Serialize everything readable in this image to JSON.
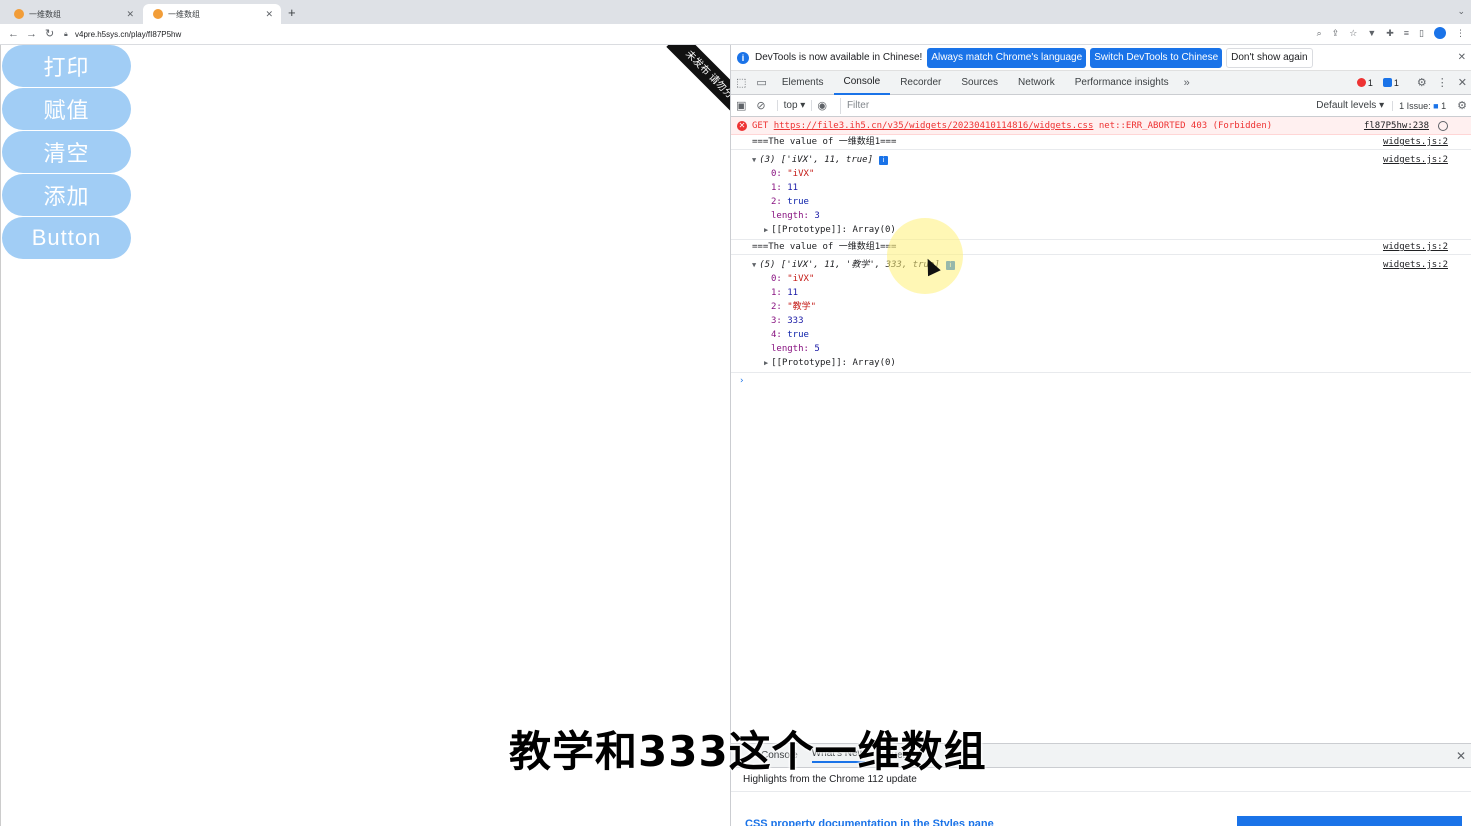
{
  "browser": {
    "tabs": [
      {
        "title": "一维数组",
        "active": false
      },
      {
        "title": "一维数组",
        "active": true
      }
    ],
    "address": "v4pre.h5sys.cn/play/fI87P5hw"
  },
  "page": {
    "buttons": [
      "打印",
      "赋值",
      "清空",
      "添加",
      "Button"
    ],
    "ribbon_text": "未发布 请勿分享",
    "button_color": "#a1cdf5"
  },
  "devtools": {
    "infobar": {
      "message": "DevTools is now available in Chinese!",
      "btn_match": "Always match Chrome's language",
      "btn_switch": "Switch DevTools to Chinese",
      "btn_dismiss": "Don't show again"
    },
    "tabs": [
      "Elements",
      "Console",
      "Recorder",
      "Sources",
      "Network",
      "Performance insights"
    ],
    "error_count": "1",
    "message_count": "1",
    "context": "top",
    "filter_placeholder": "Filter",
    "levels": "Default levels",
    "issues": "1 Issue:",
    "issues_count": "1",
    "console": {
      "error": {
        "method": "GET",
        "url": "https://file3.ih5.cn/v35/widgets/20230410114816/widgets.css",
        "status": "net::ERR_ABORTED 403 (Forbidden)",
        "source": "fl87P5hw:238"
      },
      "log1": {
        "text": "===The value of 一维数组1===",
        "source": "widgets.js:2"
      },
      "array1": {
        "summary": "(3) ['iVX', 11, true]",
        "source": "widgets.js:2",
        "items": [
          {
            "k": "0:",
            "v": "\"iVX\"",
            "t": "str"
          },
          {
            "k": "1:",
            "v": "11",
            "t": "num"
          },
          {
            "k": "2:",
            "v": "true",
            "t": "kw"
          },
          {
            "k": "length:",
            "v": "3",
            "t": "num"
          }
        ],
        "proto": "[[Prototype]]: Array(0)"
      },
      "log2": {
        "text": "===The value of 一维数组1===",
        "source": "widgets.js:2"
      },
      "array2": {
        "summary": "(5) ['iVX', 11, '教学', 333, true]",
        "source": "widgets.js:2",
        "items": [
          {
            "k": "0:",
            "v": "\"iVX\"",
            "t": "str"
          },
          {
            "k": "1:",
            "v": "11",
            "t": "num"
          },
          {
            "k": "2:",
            "v": "\"教学\"",
            "t": "str"
          },
          {
            "k": "3:",
            "v": "333",
            "t": "num"
          },
          {
            "k": "4:",
            "v": "true",
            "t": "kw"
          },
          {
            "k": "length:",
            "v": "5",
            "t": "num"
          }
        ],
        "proto": "[[Prototype]]: Array(0)"
      }
    },
    "drawer": {
      "tabs": [
        "Console",
        "What's New",
        "Issues"
      ],
      "headline": "Highlights from the Chrome 112 update",
      "article": "CSS property documentation in the Styles pane"
    }
  },
  "subtitle": "教学和333这个一维数组"
}
